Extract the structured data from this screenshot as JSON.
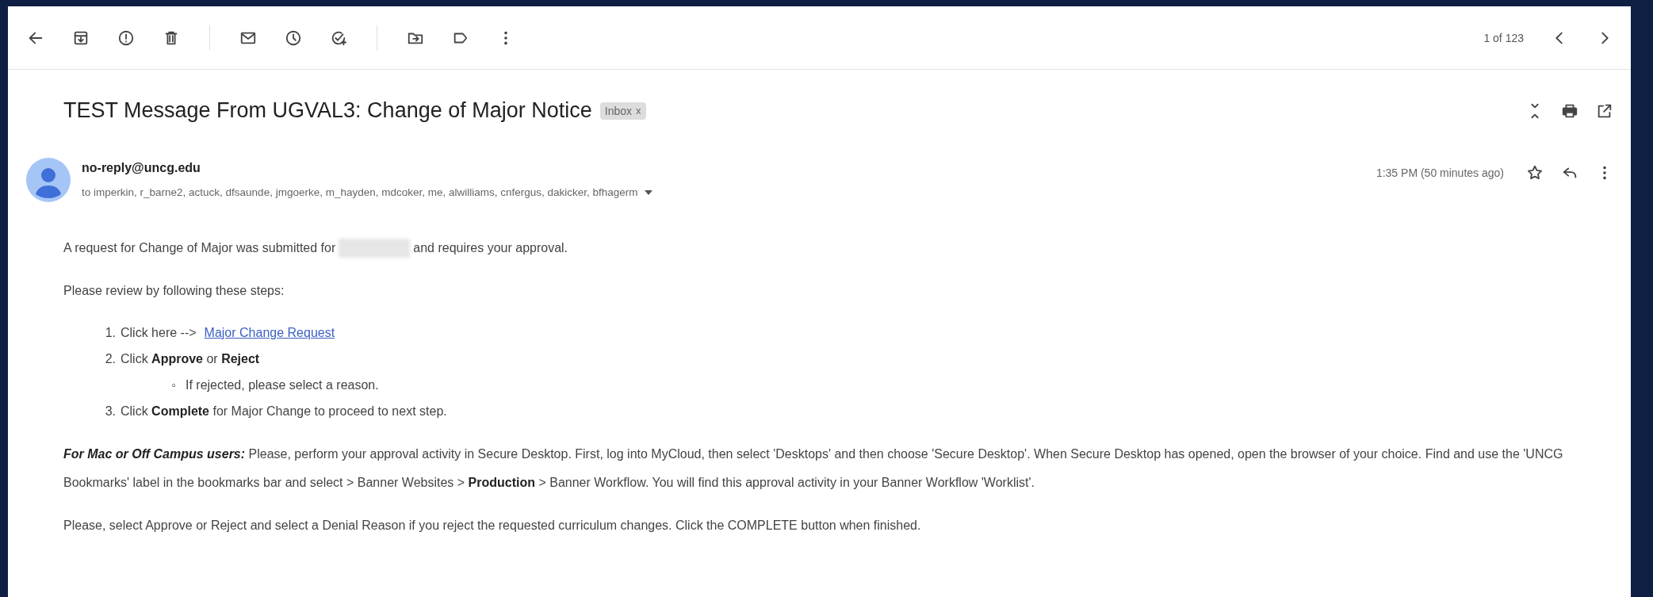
{
  "toolbar": {
    "pagination": "1 of 123"
  },
  "message": {
    "subject": "TEST Message From UGVAL3: Change of Major Notice",
    "label": {
      "text": "Inbox",
      "remove": "x"
    },
    "sender": "no-reply@uncg.edu",
    "recipients": "to imperkin, r_barne2, actuck, dfsaunde, jmgoerke, m_hayden, mdcoker, me, alwilliams, cnfergus, dakicker, bfhagerm",
    "time": "1:35 PM (50 minutes ago)",
    "starred": false
  },
  "body": {
    "intro_before": "A request for Change of Major was submitted for",
    "intro_after": "and requires your approval.",
    "review": "Please review by following these steps:",
    "steps": [
      {
        "marker": "1.",
        "text": "Click here -->",
        "link": "Major Change Request"
      },
      {
        "marker": "2.",
        "text": "Click **Approve** or **Reject**",
        "children": [
          {
            "marker": "◦",
            "text": "If rejected, please select a reason."
          }
        ]
      },
      {
        "marker": "3.",
        "text": "Click **Complete** for Major Change to proceed to next step."
      }
    ],
    "offcampus_lead": "For Mac or Off Campus users:",
    "offcampus": "Please, perform your approval activity in Secure Desktop. First, log into MyCloud, then select 'Desktops' and then choose 'Secure Desktop'. When Secure Desktop has opened, open the browser of your choice. Find and use the 'UNCG Bookmarks' label in the bookmarks bar and select > Banner Websites > **Production** > Banner Workflow. You will find this approval activity in your Banner Workflow 'Worklist'.",
    "closing": "Please, select Approve or Reject and select a Denial Reason if you reject the requested curriculum changes. Click the COMPLETE button when finished."
  }
}
